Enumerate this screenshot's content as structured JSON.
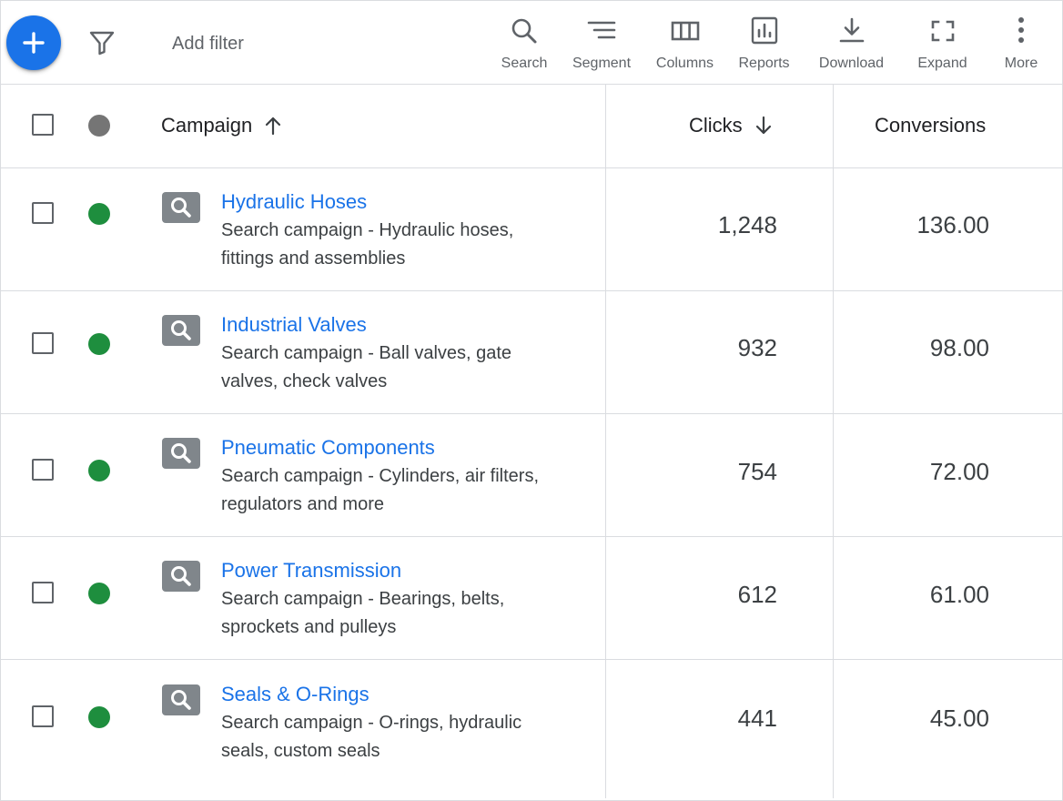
{
  "toolbar": {
    "add_filter": "Add filter",
    "tools": [
      {
        "label": "Search",
        "icon": "search-icon"
      },
      {
        "label": "Segment",
        "icon": "segment-icon"
      },
      {
        "label": "Columns",
        "icon": "columns-icon"
      },
      {
        "label": "Reports",
        "icon": "reports-icon"
      },
      {
        "label": "Download",
        "icon": "download-icon"
      },
      {
        "label": "Expand",
        "icon": "expand-icon"
      },
      {
        "label": "More",
        "icon": "more-vert-icon"
      }
    ]
  },
  "table": {
    "headers": {
      "campaign": "Campaign",
      "clicks": "Clicks",
      "conversions": "Conversions"
    },
    "rows": [
      {
        "name": "Hydraulic Hoses",
        "description": "Search campaign - Hydraulic hoses, fittings and assemblies",
        "clicks": "1,248",
        "conversions": "136.00",
        "status": "enabled"
      },
      {
        "name": "Industrial Valves",
        "description": "Search campaign - Ball valves, gate valves, check valves",
        "clicks": "932",
        "conversions": "98.00",
        "status": "enabled"
      },
      {
        "name": "Pneumatic Components",
        "description": "Search campaign - Cylinders, air filters, regulators and more",
        "clicks": "754",
        "conversions": "72.00",
        "status": "enabled"
      },
      {
        "name": "Power Transmission",
        "description": "Search campaign - Bearings, belts, sprockets and pulleys",
        "clicks": "612",
        "conversions": "61.00",
        "status": "enabled"
      },
      {
        "name": "Seals & O-Rings",
        "description": "Search campaign - O-rings, hydraulic seals, custom seals",
        "clicks": "441",
        "conversions": "45.00",
        "status": "enabled"
      }
    ]
  },
  "colors": {
    "accent": "#1a73e8",
    "status_enabled": "#1e8e3e",
    "status_header": "#757575",
    "icon_gray": "#5f6368"
  }
}
